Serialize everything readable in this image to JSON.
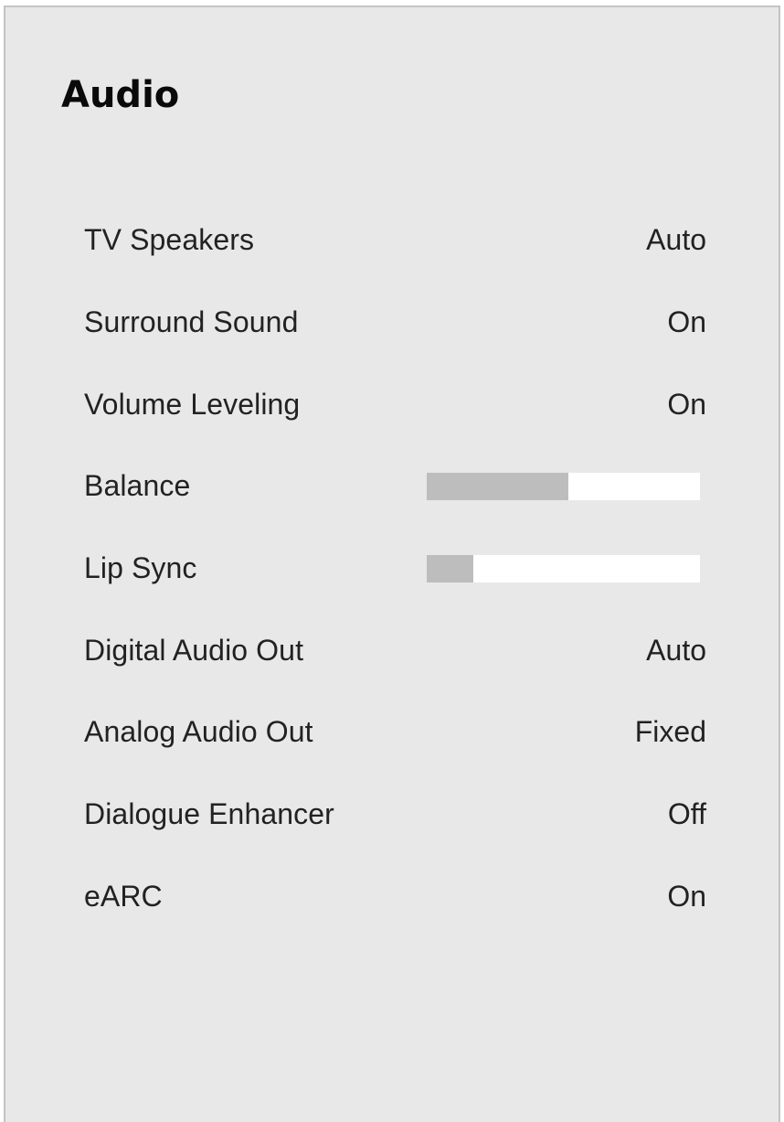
{
  "menu": {
    "title": "Audio",
    "items": [
      {
        "label": "TV Speakers",
        "value": "Auto"
      },
      {
        "label": "Surround Sound",
        "value": "On"
      },
      {
        "label": "Volume Leveling",
        "value": "On"
      },
      {
        "label": "Balance",
        "slider_level": 0.52
      },
      {
        "label": "Lip Sync",
        "slider_level": 0.17
      },
      {
        "label": "Digital Audio Out",
        "value": "Auto"
      },
      {
        "label": "Analog Audio Out",
        "value": "Fixed"
      },
      {
        "label": "Dialogue Enhancer",
        "value": "Off"
      },
      {
        "label": "eARC",
        "value": "On"
      }
    ]
  },
  "colors": {
    "panel_background": "#e8e8e8",
    "panel_border": "#c4c4c4",
    "slider_track": "#ffffff",
    "slider_fill": "#bdbdbd",
    "text": "#222222"
  }
}
